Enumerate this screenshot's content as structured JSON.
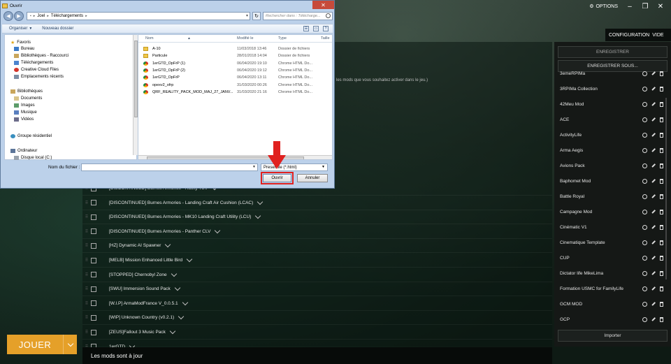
{
  "launcher": {
    "options_label": "OPTIONS",
    "config_label": "CONFIGURATION",
    "config_value": "VIDE",
    "mods_intro": "les mods que vous souhaitez activer dans le jeu.)",
    "mods": [
      "[DISCONTINUED] Burnes Armories - Husky TSV",
      "[DISCONTINUED] Burnes Armories - Landing Craft Air Cushion (LCAC)",
      "[DISCONTINUED] Burnes Armories - MK10 Landing Craft Utility (LCU)",
      "[DISCONTINUED] Burnes Armories - Panther CLV",
      "[HZ] Dynamic AI Spawner",
      "[MELB] Mission Enhanced Little Bird",
      "[STOPPED] Chernobyl Zone",
      "[SWU] Immersion Sound Pack",
      "[W.I.P] ArmaModFrance V_0.0.5.1",
      "[WIP] Unknown Country (v0.2.1)",
      "[ZEUS]Fallout 3 Music Pack",
      "1erGTD"
    ],
    "status": "Les mods sont à jour",
    "play_label": "JOUER",
    "save_label": "ENREGISTRER",
    "save_as_label": "ENREGISTRER SOUS...",
    "presets": [
      "3emeRPIMa",
      "3RPIMa Collection",
      "42Meu Mod",
      "ACE",
      "ActivityLife",
      "Arma Aegis",
      "Avions Pack",
      "Baphomet Mod",
      "Battle Royal",
      "Campagne Mod",
      "Cinématic V1",
      "Cinematique Template",
      "CUP",
      "Dictator life MikeLima",
      "Formation USMC for FamilyLife",
      "GCM MOD",
      "GCP"
    ],
    "import_label": "Importer"
  },
  "dialog": {
    "title": "Ouvrir",
    "breadcrumb": [
      "Joel",
      "Téléchargements"
    ],
    "search_placeholder": "Rechercher dans : Télécharge...",
    "toolbar": {
      "organize": "Organiser",
      "new_folder": "Nouveau dossier"
    },
    "nav": {
      "favorites": "Favoris",
      "desktop": "Bureau",
      "libraries_shortcut": "Bibliothèques - Raccourci",
      "downloads": "Téléchargements",
      "creative_cloud": "Creative Cloud Files",
      "recent": "Emplacements récents",
      "libraries": "Bibliothèques",
      "documents": "Documents",
      "images": "Images",
      "music": "Musique",
      "videos": "Vidéos",
      "homegroup": "Groupe résidentiel",
      "computer": "Ordinateur",
      "local_disk": "Disque local (C:)"
    },
    "columns": {
      "name": "Nom",
      "modified": "Modifié le",
      "type": "Type",
      "size": "Taille"
    },
    "files": [
      {
        "name": "A-10",
        "modified": "11/03/2018 13:46",
        "type": "Dossier de fichiers",
        "icon": "folder"
      },
      {
        "name": "Particule",
        "modified": "28/01/2018 14:04",
        "type": "Dossier de fichiers",
        "icon": "folder"
      },
      {
        "name": "1erGTD_OpFrP (1)",
        "modified": "06/04/2020 19:10",
        "type": "Chrome HTML Do...",
        "icon": "chrome"
      },
      {
        "name": "1erGTD_OpFrP (2)",
        "modified": "06/04/2020 19:12",
        "type": "Chrome HTML Do...",
        "icon": "chrome"
      },
      {
        "name": "1erGTD_OpFrP",
        "modified": "06/04/2020 13:11",
        "type": "Chrome HTML Do...",
        "icon": "chrome"
      },
      {
        "name": "opexv2_ofrp",
        "modified": "31/03/2020 00:26",
        "type": "Chrome HTML Do...",
        "icon": "chrome"
      },
      {
        "name": "QRF_REALITY_PACK_MOD_MAJ_27_JANV...",
        "modified": "31/03/2020 21:16",
        "type": "Chrome HTML Do...",
        "icon": "chrome"
      }
    ],
    "filename_label": "Nom du fichier :",
    "filename_value": "",
    "filter_value": "Preset file (*.html)",
    "open_label": "Ouvrir",
    "cancel_label": "Annuler"
  },
  "colors": {
    "play": "#e5a029",
    "highlight": "#e0211f"
  }
}
